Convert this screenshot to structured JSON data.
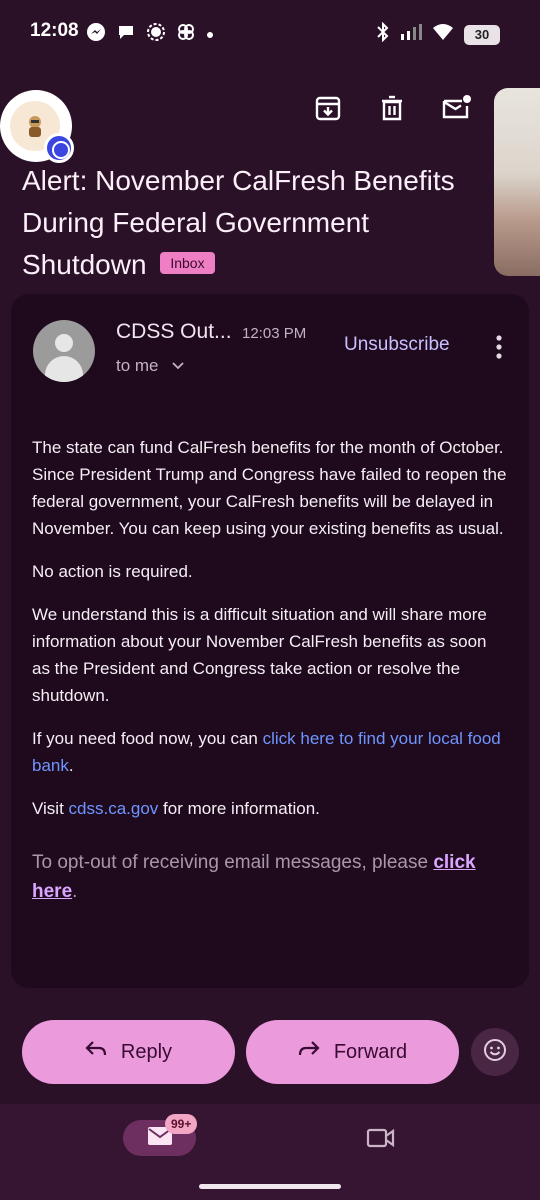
{
  "status_bar": {
    "time": "12:08",
    "battery": "30",
    "left_icons": [
      "messenger-icon",
      "chat-icon",
      "signal-icon",
      "pinwheel-icon",
      "dot-icon"
    ],
    "right_icons": [
      "bluetooth-icon",
      "cellular-icon",
      "wifi-icon",
      "battery-icon"
    ]
  },
  "toolbar": {
    "icons": [
      "archive-icon",
      "delete-icon",
      "mark-unread-icon"
    ]
  },
  "email": {
    "subject": "Alert: November CalFresh Benefits During Federal Government Shutdown",
    "label": "Inbox",
    "sender": "CDSS Out...",
    "time": "12:03 PM",
    "recipient": "to me",
    "unsubscribe": "Unsubscribe",
    "body": {
      "p1": "The state can fund CalFresh benefits for the month of October. Since President Trump and Congress have failed to reopen the federal government, your CalFresh benefits will be delayed in November. You can keep using your existing benefits as usual.",
      "p2": "No action is required.",
      "p3": "We understand this is a difficult situation and will share more information about your November CalFresh benefits as soon as the President and Congress take action or resolve the shutdown.",
      "p4_prefix": "If you need food now, you can ",
      "p4_link": "click here to find your local food bank",
      "p4_suffix": ".",
      "p5_prefix": "Visit ",
      "p5_link": "cdss.ca.gov",
      "p5_suffix": " for more information.",
      "optout_prefix": "To opt-out of receiving email messages, please ",
      "optout_link": "click here",
      "optout_suffix": "."
    }
  },
  "actions": {
    "reply": "Reply",
    "forward": "Forward"
  },
  "bottom_nav": {
    "mail_badge": "99+",
    "items": [
      "mail-icon",
      "video-icon"
    ]
  },
  "colors": {
    "background": "#2b1128",
    "card": "#1e0a1c",
    "pill": "#eb9adc",
    "link": "#6f95ff",
    "label": "#ee7fc4"
  }
}
